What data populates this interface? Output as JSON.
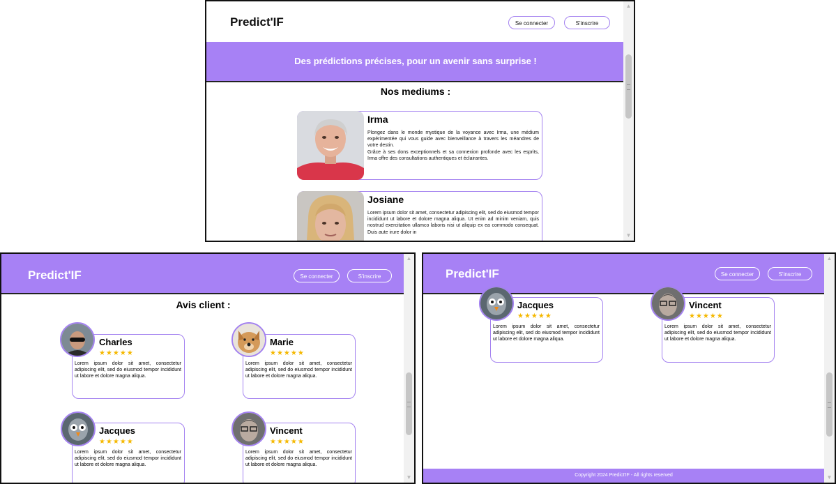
{
  "brand": "Predict'IF",
  "buttons": {
    "login": "Se connecter",
    "signup": "S'inscrire"
  },
  "banner": "Des prédictions précises, pour un avenir sans surprise !",
  "mediums_title": "Nos mediums :",
  "mediums": [
    {
      "name": "Irma",
      "desc": "Plongez dans le monde mystique de la voyance avec Irma, une médium expérimentée qui vous guide avec bienveillance à travers les méandres de votre destin.\nGrâce à ses dons exceptionnels et sa connexion profonde avec les esprits, Irma offre des consultations authentiques et éclairantes."
    },
    {
      "name": "Josiane",
      "desc": "Lorem ipsum dolor sit amet, consectetur adipiscing elit, sed do eiusmod tempor incididunt ut labore et dolore magna aliqua. Ut enim ad minim veniam, quis nostrud exercitation ullamco laboris nisi ut aliquip ex ea commodo consequat. Duis aute irure dolor in"
    }
  ],
  "reviews_title": "Avis client :",
  "reviews": [
    {
      "name": "Charles",
      "stars": "★★★★★",
      "text": "Lorem ipsum dolor sit amet, consectetur adipiscing elit, sed do eiusmod tempor incididunt ut labore et dolore magna aliqua."
    },
    {
      "name": "Marie",
      "stars": "★★★★★",
      "text": "Lorem ipsum dolor sit amet, consectetur adipiscing elit, sed do eiusmod tempor incididunt ut labore et dolore magna aliqua."
    },
    {
      "name": "Jacques",
      "stars": "★★★★★",
      "text": "Lorem ipsum dolor sit amet, consectetur adipiscing elit, sed do eiusmod tempor incididunt ut labore et dolore magna aliqua."
    },
    {
      "name": "Vincent",
      "stars": "★★★★★",
      "text": "Lorem ipsum dolor sit amet, consectetur adipiscing elit, sed do eiusmod tempor incididunt ut labore et dolore magna aliqua."
    }
  ],
  "footer": "Copyright 2024 Predict'IF - All rights reserved",
  "colors": {
    "accent": "#a781f5",
    "star": "#f5b800"
  }
}
